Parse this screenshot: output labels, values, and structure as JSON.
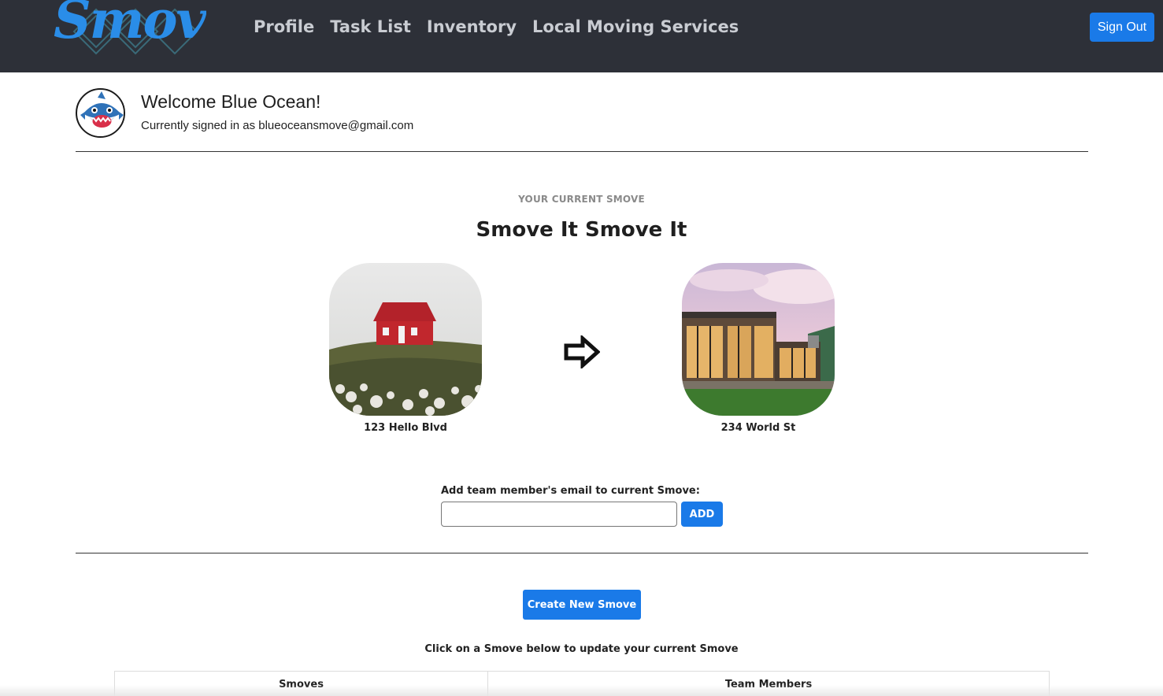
{
  "navbar": {
    "logo_text": "Smove",
    "links": [
      "Profile",
      "Task List",
      "Inventory",
      "Local Moving Services"
    ],
    "signout_label": "Sign Out"
  },
  "welcome": {
    "title": "Welcome Blue Ocean!",
    "subtitle": "Currently signed in as blueoceansmove@gmail.com"
  },
  "current_smove": {
    "overline": "YOUR CURRENT SMOVE",
    "title": "Smove It Smove It",
    "from_address": "123 Hello Blvd",
    "to_address": "234 World St"
  },
  "team": {
    "label": "Add team member's email to current Smove:",
    "email_value": "",
    "email_placeholder": "",
    "add_label": "ADD"
  },
  "create_label": "Create New Smove",
  "hint": "Click on a Smove below to update your current Smove",
  "table": {
    "headers": [
      "Smoves",
      "Team Members"
    ]
  },
  "colors": {
    "navbar": "#2d3038",
    "primary": "#1a7ae8",
    "logo": "#2a8de8"
  }
}
